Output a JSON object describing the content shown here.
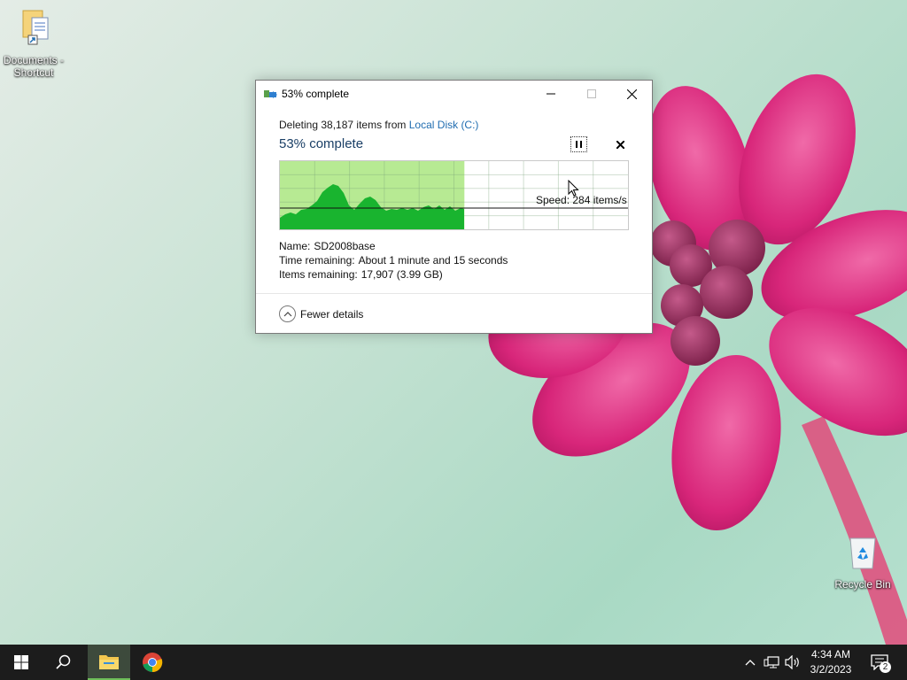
{
  "desktop": {
    "icons": [
      {
        "label_line1": "Documents -",
        "label_line2": "Shortcut",
        "icon": "folder-shortcut-icon"
      },
      {
        "label": "Recycle Bin",
        "icon": "recycle-bin-icon"
      }
    ]
  },
  "dialog": {
    "title": "53% complete",
    "operation_prefix": "Deleting 38,187 items from ",
    "operation_target": "Local Disk (C:)",
    "heading": "53% complete",
    "progress_percent": 53,
    "speed_text": "Speed: 284 items/s",
    "details": [
      {
        "key": "Name:",
        "value": "SD2008base"
      },
      {
        "key": "Time remaining:",
        "value": "About 1 minute and 15 seconds"
      },
      {
        "key": "Items remaining:",
        "value": "17,907 (3.99 GB)"
      }
    ],
    "fewer_details_label": "Fewer details",
    "colors": {
      "progress_fill": "#b7ea93",
      "graph_fill": "#19b42f",
      "link": "#1f6cb0",
      "heading": "#1a3f66"
    }
  },
  "taskbar": {
    "items": [
      "start-icon",
      "search-icon",
      "file-explorer-icon",
      "chrome-icon"
    ],
    "tray": {
      "time": "4:34 AM",
      "date": "3/2/2023",
      "notification_count": "2"
    }
  }
}
